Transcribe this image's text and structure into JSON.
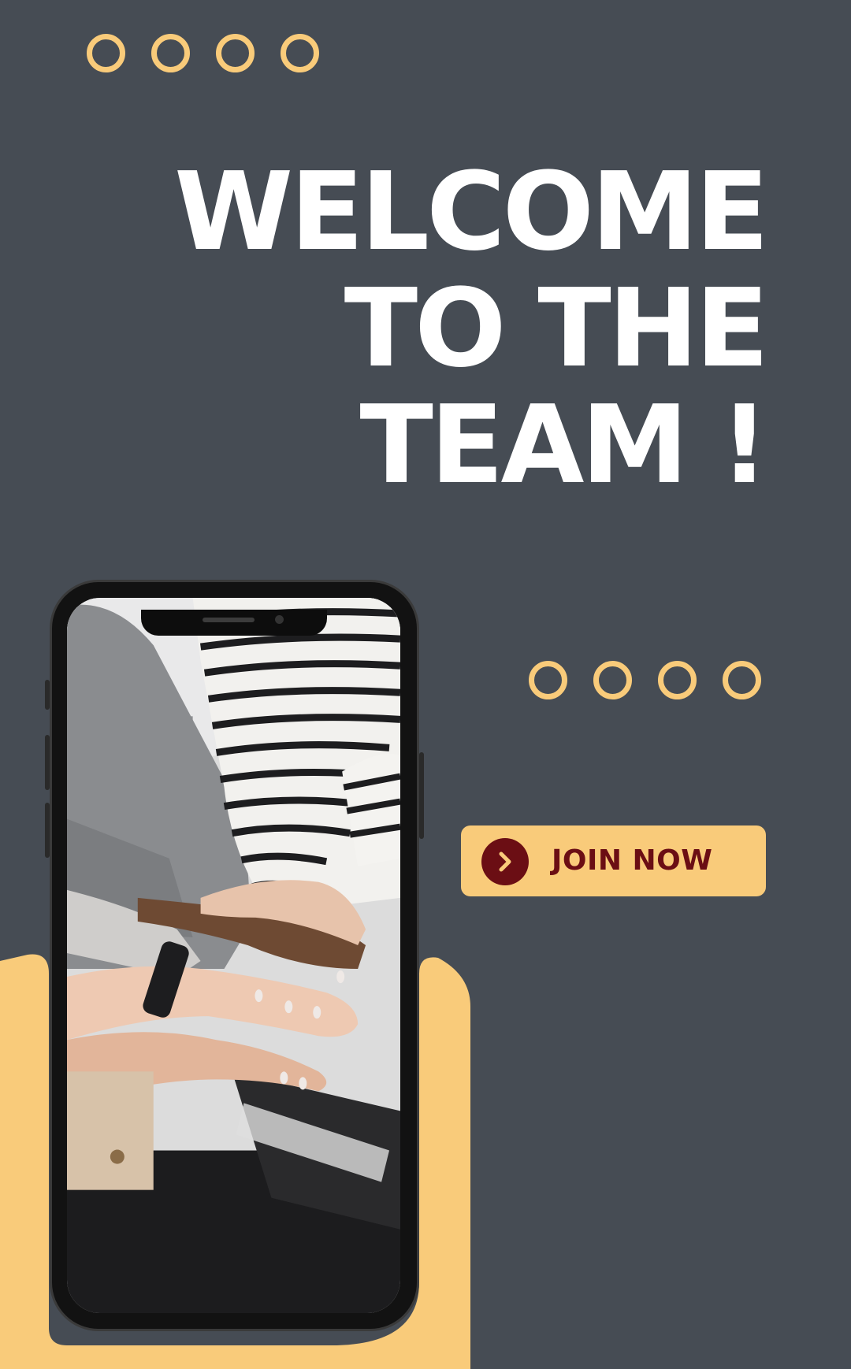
{
  "headline": {
    "line1": "WELCOME",
    "line2": "TO THE",
    "line3": "TEAM !"
  },
  "cta": {
    "label": "JOIN NOW",
    "icon": "chevron-right-icon"
  },
  "decorations": {
    "dots_top_count": 4,
    "dots_mid_count": 4
  },
  "photo": {
    "subject": "stacked-hands-photo"
  },
  "colors": {
    "background": "#464c54",
    "accent": "#f9cb7a",
    "button_text": "#6b0e14",
    "headline": "#ffffff"
  }
}
